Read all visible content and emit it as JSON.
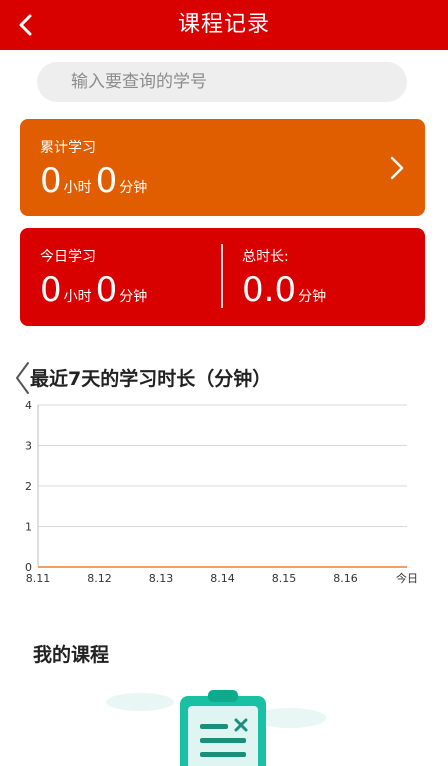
{
  "header": {
    "title": "课程记录"
  },
  "search": {
    "placeholder": "输入要查询的学号"
  },
  "total_card": {
    "label": "累计学习",
    "hours": "0",
    "hour_unit": "小时",
    "minutes": "0",
    "minute_unit": "分钟"
  },
  "today_card": {
    "label": "今日学习",
    "hours": "0",
    "hour_unit": "小时",
    "minutes": "0",
    "minute_unit": "分钟",
    "total_label": "总时长:",
    "total_value": "0.0",
    "total_unit": "分钟"
  },
  "chart_data": {
    "type": "line",
    "title": "最近7天的学习时长（分钟）",
    "categories": [
      "8.11",
      "8.12",
      "8.13",
      "8.14",
      "8.15",
      "8.16",
      "今日"
    ],
    "series": [
      {
        "values": [
          0,
          0,
          0,
          0,
          0,
          0,
          0
        ]
      }
    ],
    "ylim": [
      0,
      4
    ],
    "yticks": [
      0,
      1,
      2,
      3,
      4
    ],
    "grid": true,
    "colors": {
      "line": "#f0a060",
      "grid": "#d9d9d9",
      "axis": "#bfbfbf"
    }
  },
  "courses": {
    "title": "我的课程"
  },
  "colors": {
    "header": "#d90000",
    "total_card": "#e05e00",
    "today_card": "#d90000"
  },
  "icons": {
    "back": "chevron-left-icon",
    "card_arrow": "chevron-right-icon",
    "empty": "clipboard-icon"
  }
}
